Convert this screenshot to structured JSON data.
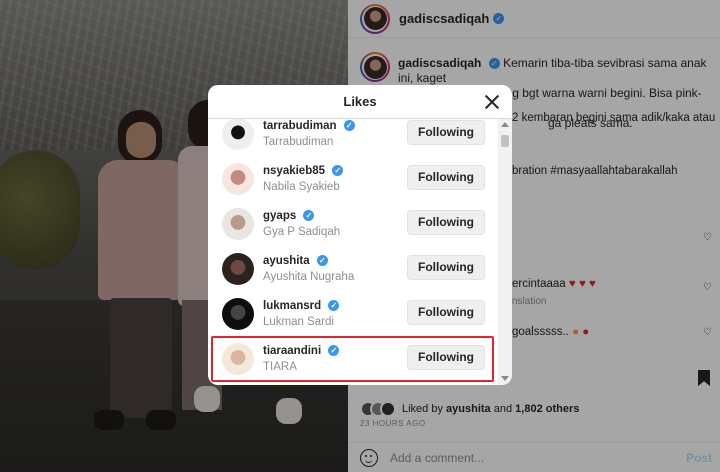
{
  "post": {
    "username": "gadiscsadiqah",
    "caption_lines": [
      "Kemarin tiba-tiba sevibrasi sama anak ini, kaget",
      "karena @gyaps jarang bgt warna warni begini. Bisa pink-ungu",
      "ga pleats sama."
    ],
    "behind_fragments": [
      "2 kembaran begini sama adik/kaka atau",
      "bration #masyaallahtabarakallah",
      "ercintaaaa",
      "nslation",
      "goalsssss.."
    ],
    "liked_by_prefix": "Liked by",
    "liked_by_user": "ayushita",
    "liked_by_and": "and",
    "liked_by_others": "1,802 others",
    "time_ago": "23 HOURS AGO",
    "comment_placeholder": "Add a comment...",
    "post_label": "Post"
  },
  "modal": {
    "title": "Likes",
    "users": [
      {
        "username": "tarrabudiman",
        "full_name": "Tarrabudiman",
        "button": "Following",
        "verified": true
      },
      {
        "username": "nsyakieb85",
        "full_name": "Nabila Syakieb",
        "button": "Following",
        "verified": true
      },
      {
        "username": "gyaps",
        "full_name": "Gya P Sadiqah",
        "button": "Following",
        "verified": true
      },
      {
        "username": "ayushita",
        "full_name": "Ayushita Nugraha",
        "button": "Following",
        "verified": true
      },
      {
        "username": "lukmansrd",
        "full_name": "Lukman Sardi",
        "button": "Following",
        "verified": true
      },
      {
        "username": "tiaraandini",
        "full_name": "TIARA",
        "button": "Following",
        "verified": true
      }
    ],
    "highlight_color": "#e0262c"
  },
  "icons": {
    "verified": "verified-badge-icon",
    "close": "close-icon",
    "heart": "heart-icon",
    "save": "bookmark-icon",
    "emoji": "emoji-icon"
  }
}
